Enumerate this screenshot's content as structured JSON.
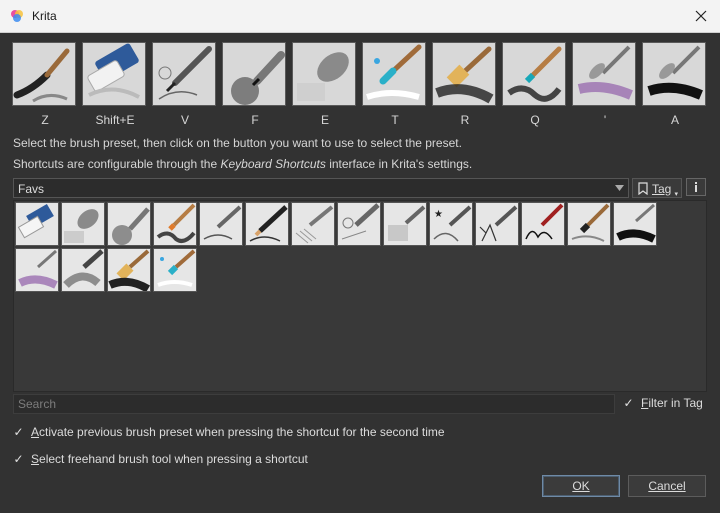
{
  "window": {
    "title": "Krita"
  },
  "slots": [
    {
      "key": "Z",
      "icon": "ink-brush-icon"
    },
    {
      "key": "Shift+E",
      "icon": "eraser-icon"
    },
    {
      "key": "V",
      "icon": "fineliner-pen-icon"
    },
    {
      "key": "F",
      "icon": "airbrush-pen-icon"
    },
    {
      "key": "E",
      "icon": "soft-eraser-icon"
    },
    {
      "key": "T",
      "icon": "wet-brush-icon"
    },
    {
      "key": "R",
      "icon": "bristle-brush-icon"
    },
    {
      "key": "Q",
      "icon": "paint-brush-icon"
    },
    {
      "key": "'",
      "icon": "palette-knife-purple-icon"
    },
    {
      "key": "A",
      "icon": "palette-knife-black-icon"
    }
  ],
  "hints": {
    "line1": "Select the brush preset, then click on the button you want to use to select the preset.",
    "line2_pre": "Shortcuts are configurable through the ",
    "line2_em": "Keyboard Shortcuts",
    "line2_post": " interface in Krita's settings."
  },
  "tag_selector": {
    "value": "Favs",
    "tag_button": "Tag"
  },
  "presets": [
    "eraser-preset-icon",
    "soft-eraser-preset-icon",
    "airbrush-pen-preset-icon",
    "paint-brush-preset-icon",
    "ink-pen-preset-icon",
    "pencil-preset-icon",
    "hatching-pen-preset-icon",
    "fineliner-preset-icon",
    "texture-brush-preset-icon",
    "sparkle-pen-preset-icon",
    "splatter-pen-preset-icon",
    "red-brush-preset-icon",
    "ink-brush-preset-icon",
    "palette-knife-black-preset-icon",
    "palette-knife-purple-preset-icon",
    "smudge-brush-preset-icon",
    "bristle-brush-preset-icon",
    "wet-brush-preset-icon"
  ],
  "search": {
    "placeholder": "Search"
  },
  "filter_in_tag": {
    "label": "Filter in Tag",
    "checked": true
  },
  "options": {
    "activate_previous": {
      "label_ul": "A",
      "label_rest": "ctivate previous brush preset when pressing the shortcut for the second time",
      "checked": true
    },
    "select_freehand": {
      "label_ul": "S",
      "label_rest": "elect freehand brush tool when pressing a shortcut",
      "checked": true
    }
  },
  "buttons": {
    "ok": "OK",
    "cancel": "Cancel"
  }
}
